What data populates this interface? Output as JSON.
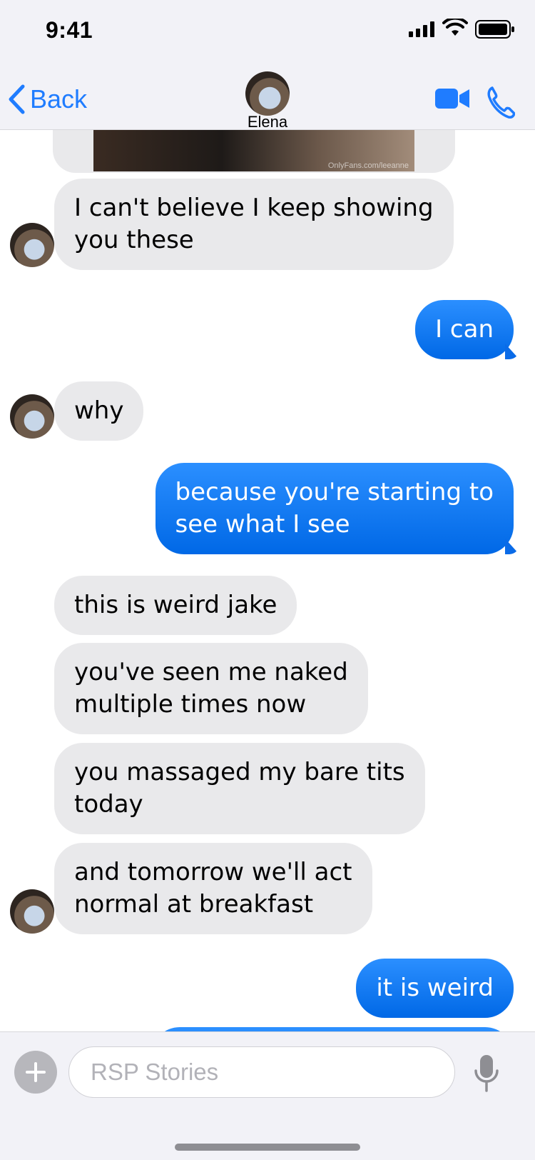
{
  "status_bar": {
    "time": "9:41"
  },
  "nav": {
    "back_label": "Back",
    "contact_name": "Elena"
  },
  "attachment": {
    "watermark": "OnlyFans.com/leeanne"
  },
  "messages": [
    {
      "sender": "them",
      "text": "I can't believe I keep showing\nyou these"
    },
    {
      "sender": "me",
      "text": "I can"
    },
    {
      "sender": "them",
      "text": "why"
    },
    {
      "sender": "me",
      "text": "because you're starting to\nsee what I see"
    },
    {
      "sender": "them",
      "text": "this is weird jake"
    },
    {
      "sender": "them",
      "text": "you've seen me naked\nmultiple times now"
    },
    {
      "sender": "them",
      "text": "you massaged my bare tits\ntoday"
    },
    {
      "sender": "them",
      "text": "and tomorrow we'll act\nnormal at breakfast"
    },
    {
      "sender": "me",
      "text": "it is weird"
    }
  ],
  "composer": {
    "placeholder": "RSP Stories"
  },
  "colors": {
    "accent": "#1f7cff",
    "incoming_bubble": "#e9e9eb",
    "outgoing_bubble": "#0a76f5"
  }
}
